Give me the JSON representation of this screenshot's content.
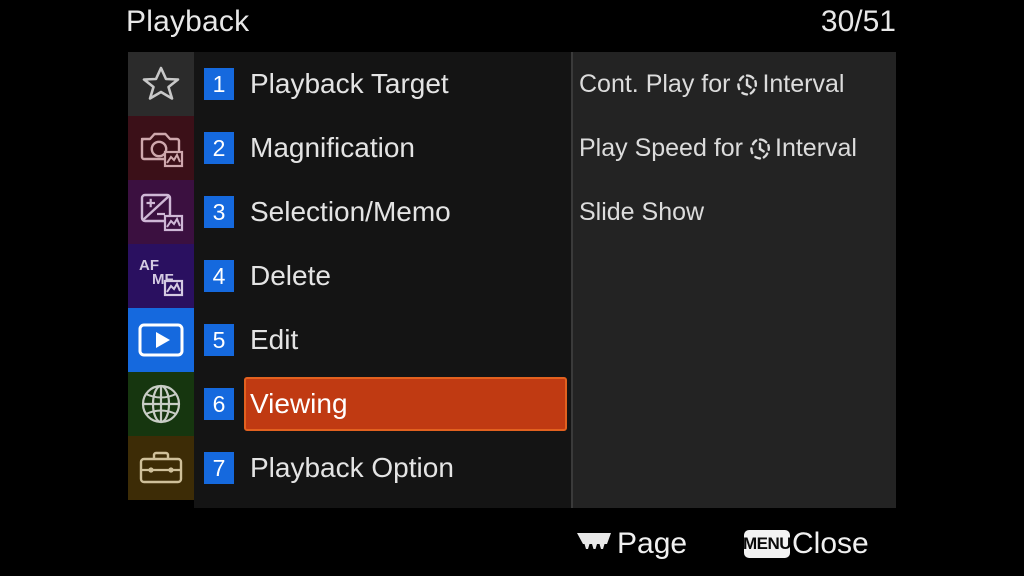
{
  "header": {
    "title": "Playback",
    "counter": "30/51"
  },
  "sidebar": {
    "items": [
      {
        "name": "my-menu",
        "icon": "star-icon",
        "bg": "#2b2b2b"
      },
      {
        "name": "shooting",
        "icon": "camera-photo-icon",
        "bg": "#3b1018"
      },
      {
        "name": "exposure-color",
        "icon": "exposure-photo-icon",
        "bg": "#3b1040"
      },
      {
        "name": "focus",
        "icon": "af-mf-photo-icon",
        "bg": "#2a1060"
      },
      {
        "name": "playback",
        "icon": "playback-icon",
        "bg": "#1569de"
      },
      {
        "name": "network",
        "icon": "globe-icon",
        "bg": "#16360f"
      },
      {
        "name": "setup",
        "icon": "toolbox-icon",
        "bg": "#3d2c06"
      }
    ]
  },
  "menu": {
    "items": [
      {
        "number": "1",
        "label": "Playback Target",
        "selected": false
      },
      {
        "number": "2",
        "label": "Magnification",
        "selected": false
      },
      {
        "number": "3",
        "label": "Selection/Memo",
        "selected": false
      },
      {
        "number": "4",
        "label": "Delete",
        "selected": false
      },
      {
        "number": "5",
        "label": "Edit",
        "selected": false
      },
      {
        "number": "6",
        "label": "Viewing",
        "selected": true
      },
      {
        "number": "7",
        "label": "Playback Option",
        "selected": false
      }
    ],
    "highlight_color": "#c03a12",
    "highlight_border_color": "#e2611f",
    "badge_color": "#1569de"
  },
  "detail": {
    "rows": [
      {
        "prefix": "Cont. Play for",
        "icon": "interval-icon",
        "suffix": "Interval"
      },
      {
        "prefix": "Play Speed for",
        "icon": "interval-icon",
        "suffix": "Interval"
      },
      {
        "prefix": "Slide Show",
        "icon": "",
        "suffix": ""
      }
    ]
  },
  "bottom_bar": {
    "page_icon": "control-dial-icon",
    "page_label": "Page",
    "menu_chip_label": "MENU",
    "close_label": "Close"
  }
}
